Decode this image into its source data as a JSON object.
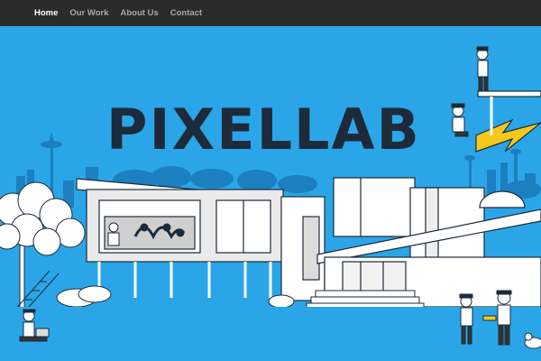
{
  "nav": {
    "items": [
      {
        "label": "Home",
        "active": true
      },
      {
        "label": "Our Work",
        "active": false
      },
      {
        "label": "About Us",
        "active": false
      },
      {
        "label": "Contact",
        "active": false
      }
    ]
  },
  "hero": {
    "logo_text": "PIXEL LAB",
    "logo_left": "PIXEL",
    "logo_right": "LAB"
  },
  "colors": {
    "nav_bg": "#2b2b2b",
    "nav_active": "#ffffff",
    "nav_inactive": "#a9a9a9",
    "sky": "#2aa6e8",
    "skyline": "#1b7fc0",
    "logo": "#1d2a3a",
    "bolt": "#f5c81c"
  }
}
